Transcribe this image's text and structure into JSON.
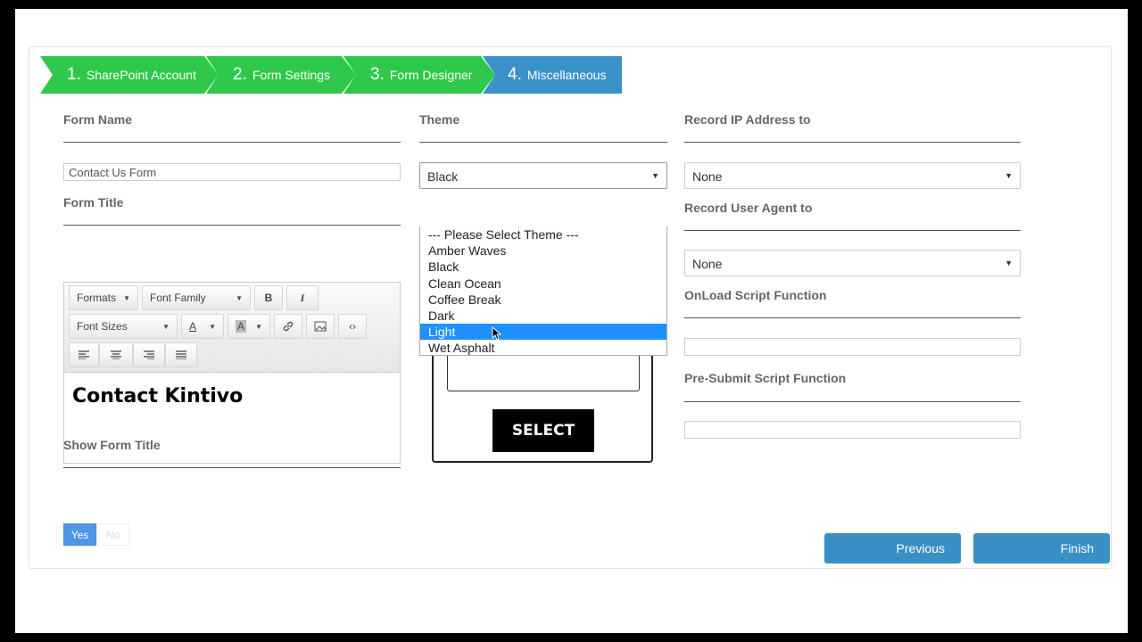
{
  "wizard": {
    "steps": [
      {
        "num": "1.",
        "label": "SharePoint Account"
      },
      {
        "num": "2.",
        "label": "Form Settings"
      },
      {
        "num": "3.",
        "label": "Form Designer"
      },
      {
        "num": "4.",
        "label": "Miscellaneous"
      }
    ],
    "colors": {
      "done": "#2ec84a",
      "active": "#3a92c8"
    }
  },
  "left": {
    "form_name_label": "Form Name",
    "form_name_value": "Contact Us Form",
    "form_title_label": "Form Title",
    "show_title_label": "Show Form Title",
    "toggle": {
      "yes": "Yes",
      "no": "No",
      "selected": "Yes"
    }
  },
  "editor": {
    "formats": "Formats",
    "font_family": "Font Family",
    "bold": "B",
    "italic": "I",
    "font_sizes": "Font Sizes",
    "font_color": "A",
    "bg_color": "A",
    "link_icon": "link-icon",
    "image_icon": "image-icon",
    "code": "‹›",
    "align_icons": [
      "align-left-icon",
      "align-center-icon",
      "align-right-icon",
      "align-justify-icon"
    ],
    "content": "Contact Kintivo"
  },
  "theme": {
    "label": "Theme",
    "selected": "Black",
    "options": [
      "--- Please Select Theme ---",
      "Amber Waves",
      "Black",
      "Clean Ocean",
      "Coffee Break",
      "Dark",
      "Light",
      "Wet Asphalt"
    ],
    "highlighted": "Light",
    "preview_button": "SELECT"
  },
  "right": {
    "record_ip_label": "Record IP Address to",
    "record_ip_value": "None",
    "record_ua_label": "Record User Agent to",
    "record_ua_value": "None",
    "onload_label": "OnLoad Script Function",
    "onload_value": "",
    "presubmit_label": "Pre-Submit Script Function",
    "presubmit_value": ""
  },
  "actions": {
    "previous": "Previous",
    "finish": "Finish"
  }
}
